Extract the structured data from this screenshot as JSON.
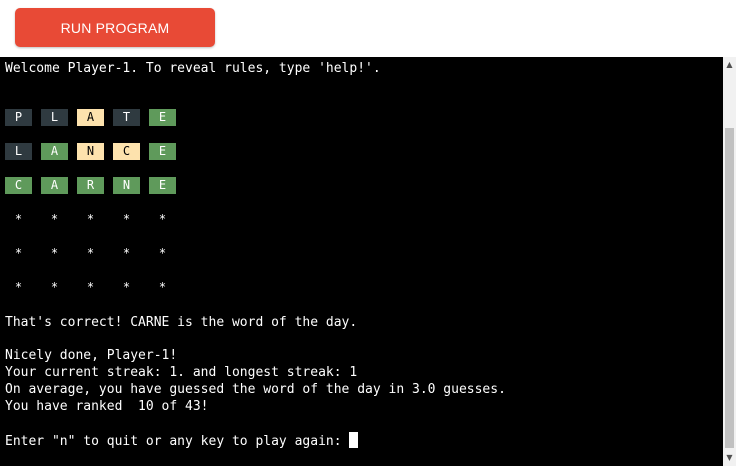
{
  "toolbar": {
    "run_label": "RUN PROGRAM"
  },
  "colors": {
    "run_button": "#e84a36",
    "terminal_bg": "#000000",
    "tile_gray": "#2f3a40",
    "tile_green": "#5f9a5b",
    "tile_yellow": "#fde2ad"
  },
  "terminal": {
    "welcome": "Welcome Player-1. To reveal rules, type 'help!'.",
    "board": [
      {
        "letters": [
          "P",
          "L",
          "A",
          "T",
          "E"
        ],
        "states": [
          "gray",
          "gray",
          "yellow",
          "gray",
          "green"
        ]
      },
      {
        "letters": [
          "L",
          "A",
          "N",
          "C",
          "E"
        ],
        "states": [
          "gray",
          "green",
          "yellow",
          "yellow",
          "green"
        ]
      },
      {
        "letters": [
          "C",
          "A",
          "R",
          "N",
          "E"
        ],
        "states": [
          "green",
          "green",
          "green",
          "green",
          "green"
        ]
      },
      {
        "letters": [
          "*",
          "*",
          "*",
          "*",
          "*"
        ],
        "states": [
          "empty",
          "empty",
          "empty",
          "empty",
          "empty"
        ]
      },
      {
        "letters": [
          "*",
          "*",
          "*",
          "*",
          "*"
        ],
        "states": [
          "empty",
          "empty",
          "empty",
          "empty",
          "empty"
        ]
      },
      {
        "letters": [
          "*",
          "*",
          "*",
          "*",
          "*"
        ],
        "states": [
          "empty",
          "empty",
          "empty",
          "empty",
          "empty"
        ]
      }
    ],
    "correct_line": "That's correct! CARNE is the word of the day.",
    "nicely_done": "Nicely done, Player-1!",
    "streak_line": "Your current streak: 1. and longest streak: 1",
    "average_line": "On average, you have guessed the word of the day in 3.0 guesses.",
    "rank_line": "You have ranked  10 of 43!",
    "prompt": "Enter \"n\" to quit or any key to play again: "
  },
  "scrollbar": {
    "up_icon": "up-arrow",
    "down_icon": "down-arrow"
  }
}
